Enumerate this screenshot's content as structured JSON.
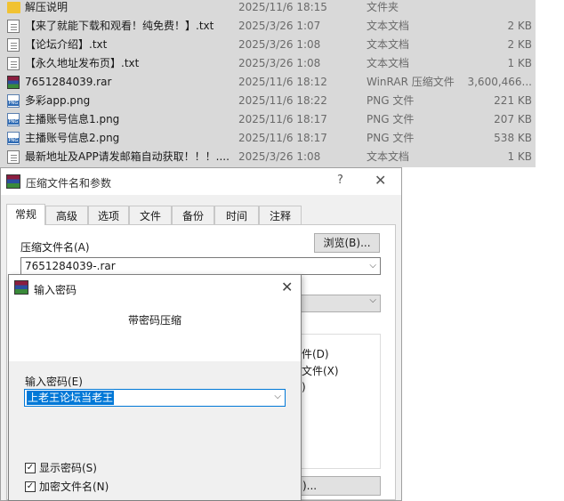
{
  "file_list": {
    "rows": [
      {
        "name": "解压说明",
        "date": "2025/11/6 18:15",
        "type": "文件夹",
        "size": "",
        "icon": "folder-icon"
      },
      {
        "name": "【来了就能下载和观看！纯免费！】.txt",
        "date": "2025/3/26 1:07",
        "type": "文本文档",
        "size": "2 KB",
        "icon": "txt-file-icon"
      },
      {
        "name": "【论坛介绍】.txt",
        "date": "2025/3/26 1:08",
        "type": "文本文档",
        "size": "2 KB",
        "icon": "txt-file-icon"
      },
      {
        "name": "【永久地址发布页】.txt",
        "date": "2025/3/26 1:08",
        "type": "文本文档",
        "size": "1 KB",
        "icon": "txt-file-icon"
      },
      {
        "name": "7651284039.rar",
        "date": "2025/11/6 18:12",
        "type": "WinRAR 压缩文件",
        "size": "3,600,466...",
        "icon": "rar-file-icon"
      },
      {
        "name": "多彩app.png",
        "date": "2025/11/6 18:22",
        "type": "PNG 文件",
        "size": "221 KB",
        "icon": "png-file-icon"
      },
      {
        "name": "主播账号信息1.png",
        "date": "2025/11/6 18:17",
        "type": "PNG 文件",
        "size": "207 KB",
        "icon": "png-file-icon"
      },
      {
        "name": "主播账号信息2.png",
        "date": "2025/11/6 18:17",
        "type": "PNG 文件",
        "size": "538 KB",
        "icon": "png-file-icon"
      },
      {
        "name": "最新地址及APP请发邮箱自动获取！！！....",
        "date": "2025/3/26 1:08",
        "type": "文本文档",
        "size": "1 KB",
        "icon": "txt-file-icon"
      }
    ]
  },
  "zip_dialog": {
    "title": "压缩文件名和参数",
    "help": "?",
    "close": "✕",
    "tabs": [
      "常规",
      "高级",
      "选项",
      "文件",
      "备份",
      "时间",
      "注释"
    ],
    "archive_name_label": "压缩文件名(A)",
    "browse_label": "浏览(B)...",
    "archive_name_value": "7651284039-.rar",
    "partial_option_1": "件(D)",
    "partial_option_2": "文件(X)",
    "partial_option_3": ")",
    "partial_button": ")..."
  },
  "password_dialog": {
    "title": "输入密码",
    "close": "✕",
    "heading": "带密码压缩",
    "input_label": "输入密码(E)",
    "input_value": "上老王论坛当老王",
    "show_password_label": "显示密码(S)",
    "show_password_checked": true,
    "encrypt_names_label": "加密文件名(N)",
    "encrypt_names_checked": true
  }
}
